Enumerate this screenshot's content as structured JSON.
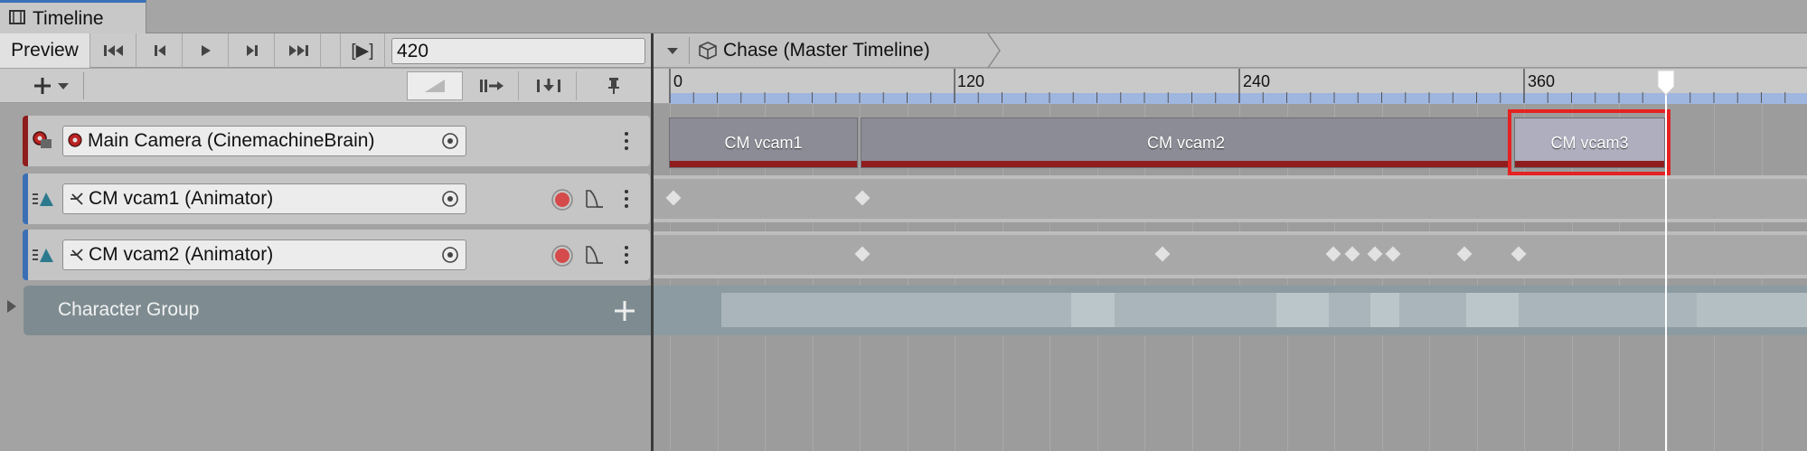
{
  "window": {
    "tab_title": "Timeline"
  },
  "toolbar": {
    "preview_label": "Preview",
    "play_range_label": "[▶]",
    "current_frame": "420"
  },
  "breadcrumb": {
    "label": "Chase (Master Timeline)"
  },
  "ruler": {
    "ticks": [
      "0",
      "120",
      "240",
      "360"
    ]
  },
  "tracks": [
    {
      "name": "Main Camera (CinemachineBrain)",
      "color": "#8f1d1d"
    },
    {
      "name": "CM vcam1 (Animator)",
      "color": "#3b6fb5"
    },
    {
      "name": "CM vcam2 (Animator)",
      "color": "#3b6fb5"
    }
  ],
  "group": {
    "name": "Character Group"
  },
  "clips": [
    {
      "label": "CM vcam1"
    },
    {
      "label": "CM vcam2"
    },
    {
      "label": "CM vcam3",
      "selected": true
    }
  ],
  "colors": {
    "highlight": "#e52222",
    "selection": "#ffffff",
    "record": "#d54b4b",
    "ruler_band": "#9fb6df"
  }
}
